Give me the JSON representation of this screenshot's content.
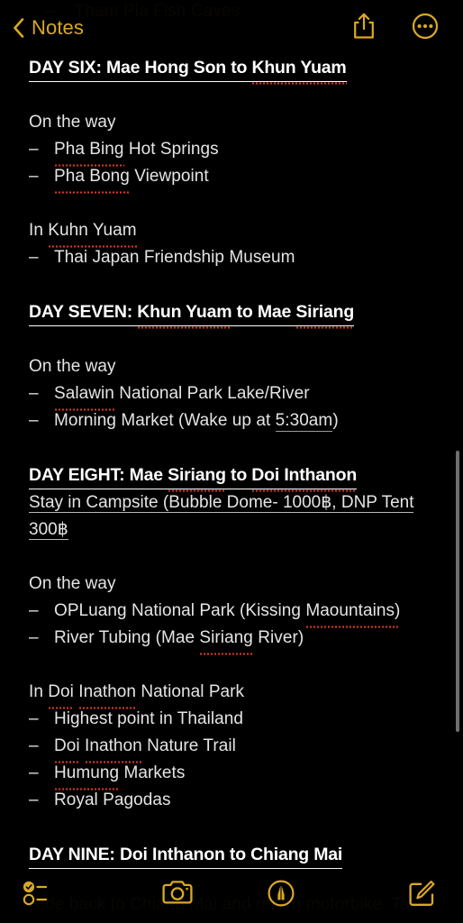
{
  "app": {
    "accent_color": "#D9A826",
    "background_color": "#000000",
    "text_color": "#E4E4E4",
    "spellcheck_color": "#E03A25"
  },
  "navbar": {
    "back_label": "Notes",
    "back_icon": "chevron-left-icon",
    "share_icon": "share-icon",
    "more_icon": "more-options-icon"
  },
  "ghost": {
    "top_dash": "–",
    "top_text": "Tham Pla Fish Caves",
    "bottom_text": "Ride back to Chiang Mai and return motorbike. Take"
  },
  "note": {
    "blocks": [
      {
        "id": "h_day6",
        "text": "DAY SIX: Mae Hong Son to Khun Yuam"
      },
      {
        "id": "p_otw1",
        "text": "On the way"
      },
      {
        "id": "b_phabing",
        "dash": "–",
        "text": "Pha Bing Hot Springs"
      },
      {
        "id": "b_phabong",
        "dash": "–",
        "text": "Pha Bong Viewpoint"
      },
      {
        "id": "p_inkuhn",
        "text": "In Kuhn Yuam"
      },
      {
        "id": "b_thaijapan",
        "dash": "–",
        "text": "Thai Japan Friendship Museum"
      },
      {
        "id": "h_day7",
        "text": "DAY SEVEN: Khun Yuam to Mae Siriang"
      },
      {
        "id": "p_otw2",
        "text": "On the way"
      },
      {
        "id": "b_salawin",
        "dash": "–",
        "text": "Salawin National Park Lake/River"
      },
      {
        "id": "b_morning_a",
        "dash": "–",
        "text": "Morning Market (Wake up at "
      },
      {
        "id": "b_morning_time",
        "text": "5:30am"
      },
      {
        "id": "b_morning_b",
        "text": ")"
      },
      {
        "id": "h_day8",
        "text": "DAY EIGHT: Mae Siriang to Doi Inthanon"
      },
      {
        "id": "p_stay",
        "text": "Stay in Campsite (Bubble Dome- 1000฿, DNP Tent 300฿"
      },
      {
        "id": "p_otw3",
        "text": "On the way"
      },
      {
        "id": "b_opluang",
        "dash": "–",
        "text": "OPLuang National Park (Kissing Maountains)"
      },
      {
        "id": "b_rivertub",
        "dash": "–",
        "text": "River Tubing (Mae Siriang River)"
      },
      {
        "id": "p_indoi",
        "text": "In Doi Inathon National Park"
      },
      {
        "id": "b_highest",
        "dash": "–",
        "text": "Highest point in Thailand"
      },
      {
        "id": "b_naturetrail",
        "dash": "–",
        "text": "Doi Inathon Nature Trail"
      },
      {
        "id": "b_humung",
        "dash": "–",
        "text": "Humung Markets"
      },
      {
        "id": "b_royal",
        "dash": "–",
        "text": "Royal Pagodas"
      },
      {
        "id": "h_day9",
        "text": "DAY NINE: Doi Inthanon to Chiang Mai"
      }
    ],
    "lines": {
      "day6_heading": "DAY SIX: Mae Hong Son to Khun Yuam",
      "day6_h_pre": "DAY SIX: Mae Hong Son to ",
      "day6_h_mis": "Khun Yuam",
      "on_the_way": "On the way",
      "pha_bing_mis": "Pha Bing",
      "pha_bing_rest": " Hot Springs",
      "pha_bong_mis": "Pha Bong",
      "pha_bong_rest": " Viewpoint",
      "in_kuhn_pre": "In ",
      "in_kuhn_mis": "Kuhn Yuam",
      "thai_japan": "Thai Japan Friendship Museum",
      "day7_h_pre": "DAY SEVEN: ",
      "day7_h_mis1": "Khun Yuam",
      "day7_h_mid": " to Mae ",
      "day7_h_mis2": "Siriang",
      "salawin_mis": "Salawin",
      "salawin_rest": " National Park Lake/River",
      "morning_pre": "Morning Market (Wake up at ",
      "morning_time": "5:30am",
      "morning_post": ")",
      "day8_h_pre": "DAY EIGHT: Mae ",
      "day8_h_mis1": "Siriang",
      "day8_h_mid": " to ",
      "day8_h_mis2": "Doi Inthanon",
      "stay_line1": "Stay in Campsite (Bubble Dome- 1000฿, DNP Tent",
      "stay_line2": "300฿",
      "opluang_pre": "OPLuang National Park (Kissing ",
      "opluang_mis": "Maountains)",
      "rivertub_pre": "River Tubing (Mae ",
      "rivertub_mis": "Siriang",
      "rivertub_post": " River)",
      "indoi_pre": "In ",
      "indoi_mis1": "Doi",
      "indoi_mid": " ",
      "indoi_mis2": "Inathon",
      "indoi_post": " National Park",
      "highest": "Highest point in Thailand",
      "naturetrail_mis1": "Doi",
      "naturetrail_mid": " ",
      "naturetrail_mis2": "Inathon",
      "naturetrail_post": " Nature Trail",
      "humung_mis": "Humung",
      "humung_post": " Markets",
      "royal": "Royal Pagodas",
      "day9_heading": "DAY NINE: Doi Inthanon to Chiang Mai",
      "dash": "–"
    }
  },
  "toolbar": {
    "checklist_icon": "checklist-icon",
    "camera_icon": "camera-icon",
    "markup_icon": "markup-pen-icon",
    "compose_icon": "compose-icon"
  },
  "scrollbar": {
    "present": "true"
  }
}
